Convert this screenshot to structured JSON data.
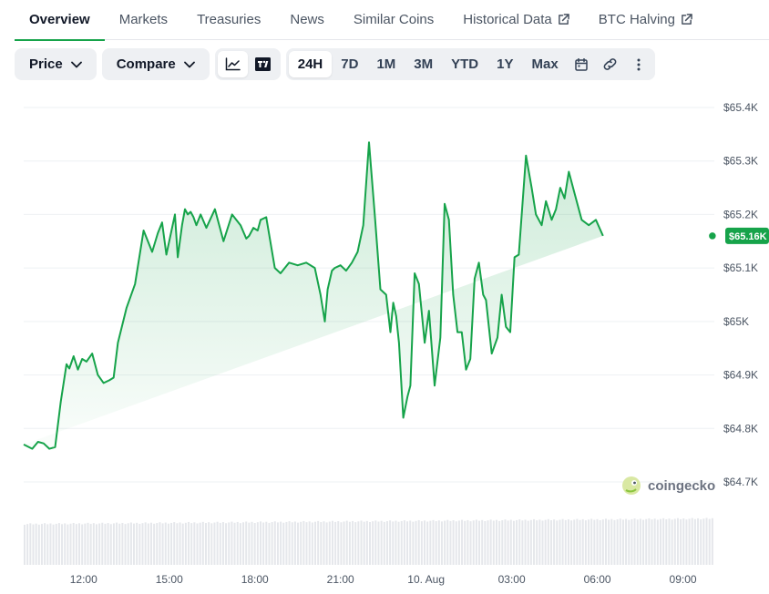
{
  "tabs": [
    {
      "label": "Overview",
      "active": true
    },
    {
      "label": "Markets"
    },
    {
      "label": "Treasuries"
    },
    {
      "label": "News"
    },
    {
      "label": "Similar Coins"
    },
    {
      "label": "Historical Data",
      "external": true
    },
    {
      "label": "BTC Halving",
      "external": true
    }
  ],
  "toolbar": {
    "price_label": "Price",
    "compare_label": "Compare",
    "chart_type_icons": [
      "line-chart-icon",
      "tradingview-icon"
    ],
    "ranges": [
      "24H",
      "7D",
      "1M",
      "3M",
      "YTD",
      "1Y",
      "Max"
    ],
    "selected_range": "24H",
    "extra_icons": [
      "calendar-icon",
      "link-icon",
      "more-icon"
    ]
  },
  "watermark": "coingecko",
  "current_price_label": "$65.16K",
  "colors": {
    "line": "#16a34a",
    "accent": "#16a34a",
    "grid": "#eef0f3",
    "volume": "#e5e7eb"
  },
  "chart_data": {
    "type": "area",
    "title": "",
    "xlabel": "",
    "ylabel": "",
    "ylim": [
      64650,
      65420
    ],
    "y_ticks": [
      64700,
      64800,
      64900,
      65000,
      65100,
      65200,
      65300,
      65400
    ],
    "y_tick_labels": [
      "$64.7K",
      "$64.8K",
      "$64.9K",
      "$65K",
      "$65.1K",
      "$65.2K",
      "$65.3K",
      "$65.4K"
    ],
    "x_tick_labels": [
      "12:00",
      "15:00",
      "18:00",
      "21:00",
      "10. Aug",
      "03:00",
      "06:00",
      "09:00"
    ],
    "x_tick_hours": [
      12,
      15,
      18,
      21,
      24,
      27,
      30,
      33
    ],
    "xlim_hours": [
      9.9,
      34.1
    ],
    "series": [
      {
        "x_hours": [
          9.9,
          10.2,
          10.4,
          10.6,
          10.8,
          11.0,
          11.2,
          11.4,
          11.5,
          11.65,
          11.8,
          11.95,
          12.1,
          12.3,
          12.5,
          12.7,
          12.9,
          13.05,
          13.2,
          13.5,
          13.8,
          14.1,
          14.4,
          14.6,
          14.75,
          14.9,
          15.2,
          15.3,
          15.45,
          15.55,
          15.65,
          15.75,
          15.85,
          15.95,
          16.1,
          16.3,
          16.6,
          16.9,
          17.2,
          17.5,
          17.7,
          17.8,
          17.95,
          18.1,
          18.2,
          18.4,
          18.7,
          18.9,
          19.2,
          19.5,
          19.8,
          20.1,
          20.3,
          20.45,
          20.55,
          20.7,
          20.8,
          21.0,
          21.2,
          21.4,
          21.6,
          21.8,
          22.0,
          22.2,
          22.4,
          22.6,
          22.75,
          22.85,
          22.95,
          23.05,
          23.2,
          23.35,
          23.45,
          23.6,
          23.75,
          23.95,
          24.1,
          24.3,
          24.5,
          24.65,
          24.8,
          24.95,
          25.1,
          25.25,
          25.4,
          25.55,
          25.7,
          25.85,
          26.0,
          26.1,
          26.3,
          26.5,
          26.65,
          26.8,
          26.95,
          27.1,
          27.25,
          27.5,
          27.7,
          27.85,
          28.05,
          28.2,
          28.4,
          28.55,
          28.7,
          28.85,
          29.0,
          29.2,
          29.45,
          29.7,
          29.95,
          30.2,
          30.45,
          30.7,
          30.95,
          31.15,
          31.35,
          31.55,
          31.7,
          31.85,
          32.0,
          32.15,
          32.35,
          32.55,
          32.7,
          32.85,
          32.95,
          33.1,
          33.2,
          33.4,
          33.55,
          33.7,
          33.9,
          34.0
        ],
        "values": [
          64770,
          64762,
          64775,
          64772,
          64762,
          64765,
          64850,
          64920,
          64912,
          64935,
          64910,
          64930,
          64925,
          64940,
          64900,
          64885,
          64890,
          64895,
          64960,
          65025,
          65070,
          65170,
          65130,
          65165,
          65185,
          65125,
          65200,
          65120,
          65180,
          65210,
          65200,
          65205,
          65195,
          65180,
          65200,
          65175,
          65210,
          65150,
          65200,
          65180,
          65155,
          65160,
          65175,
          65170,
          65190,
          65195,
          65100,
          65090,
          65110,
          65105,
          65110,
          65100,
          65050,
          65000,
          65060,
          65095,
          65100,
          65105,
          65095,
          65110,
          65130,
          65180,
          65335,
          65200,
          65060,
          65050,
          64980,
          65035,
          65010,
          64960,
          64820,
          64860,
          64880,
          65090,
          65070,
          64960,
          65020,
          64880,
          64970,
          65220,
          65190,
          65050,
          64980,
          64980,
          64910,
          64930,
          65080,
          65110,
          65050,
          65040,
          64940,
          64970,
          65050,
          64990,
          64980,
          65120,
          65125,
          65310,
          65250,
          65200,
          65180,
          65225,
          65190,
          65210,
          65250,
          65230,
          65280,
          65240,
          65190,
          65180,
          65190,
          65160
        ],
        "comment": ""
      }
    ]
  }
}
